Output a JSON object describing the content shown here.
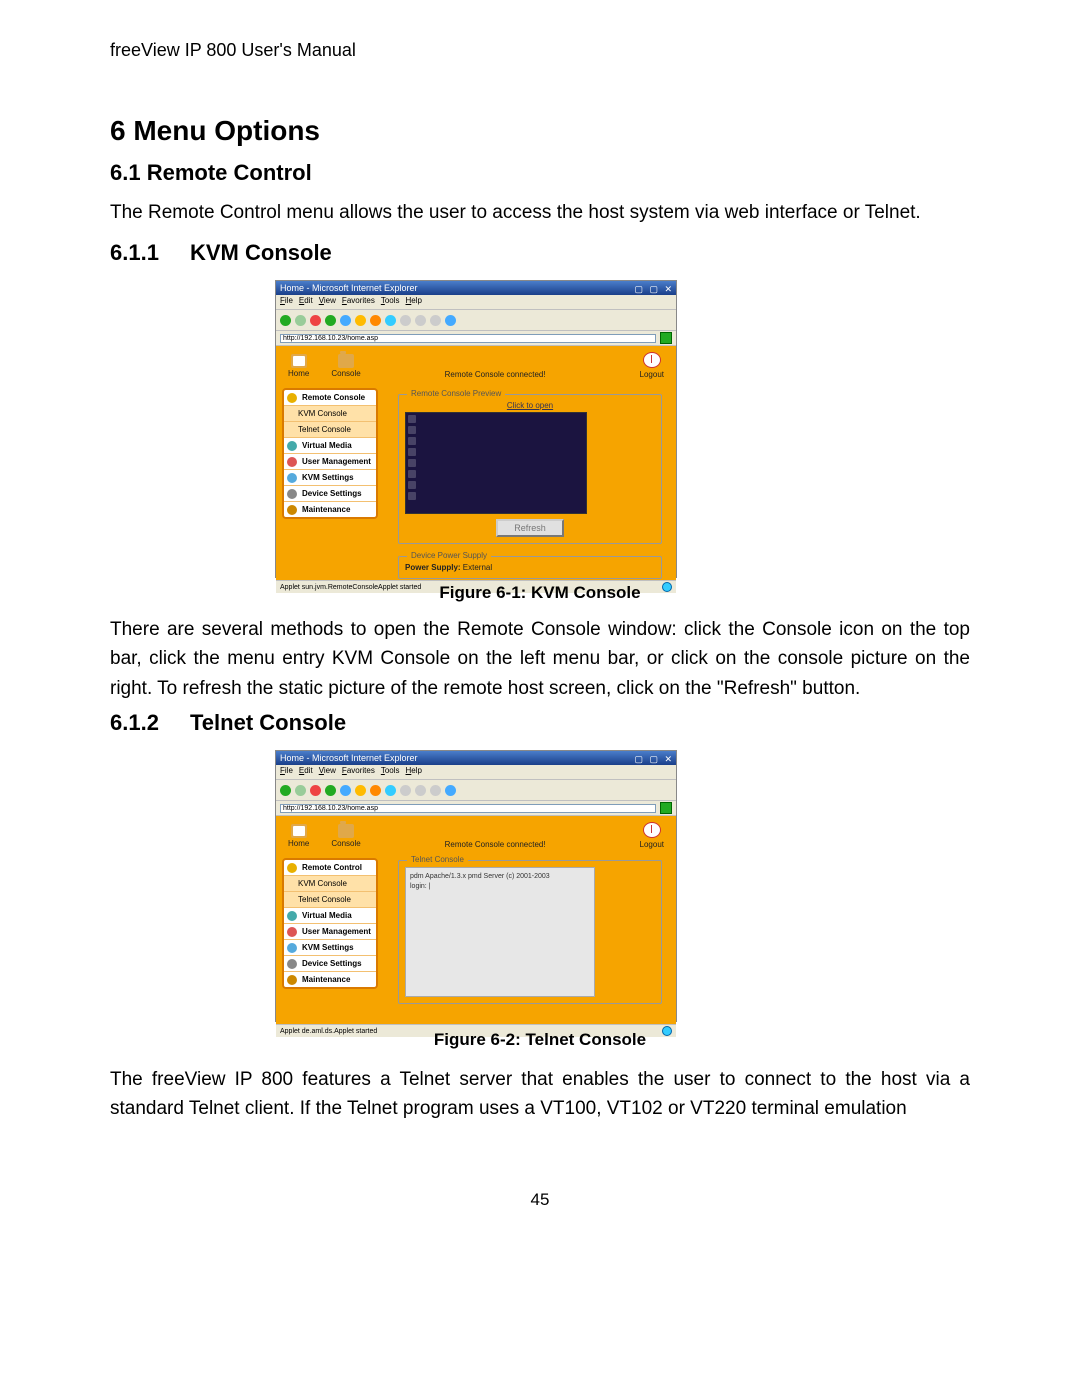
{
  "doc": {
    "header": "freeView IP 800 User's Manual",
    "page_number": "45",
    "h1": "6   Menu Options",
    "s6_1": "6.1    Remote Control",
    "p6_1": "The Remote Control menu allows the user to access the host system via web interface or Telnet.",
    "s6_1_1_num": "6.1.1",
    "s6_1_1_title": "KVM Console",
    "fig1_caption": "Figure 6-1: KVM Console",
    "p6_1_1": "There are several methods to open the Remote Console window: click the Console icon on the top bar, click the menu entry KVM Console on the left menu bar, or click on the console picture on the right. To refresh the static picture of the remote host screen, click on the \"Refresh\" button.",
    "s6_1_2_num": "6.1.2",
    "s6_1_2_title": "Telnet Console",
    "fig2_caption": "Figure 6-2: Telnet Console",
    "p6_1_2": "The freeView IP 800 features a Telnet server that enables the user to connect to the host via a standard Telnet client. If the Telnet program uses a VT100, VT102 or VT220 terminal emulation"
  },
  "browser": {
    "title": "Home - Microsoft Internet Explorer",
    "menus": [
      "File",
      "Edit",
      "View",
      "Favorites",
      "Tools",
      "Help"
    ],
    "address": "http://192.168.10.23/home.asp",
    "status1": "Applet sun.jvm.RemoteConsoleApplet started",
    "status2": "Applet de.aml.ds.Applet started"
  },
  "toolbar_icons": [
    {
      "name": "back-icon",
      "color": "#2a2"
    },
    {
      "name": "forward-icon",
      "color": "#9c9"
    },
    {
      "name": "stop-icon",
      "color": "#e44"
    },
    {
      "name": "refresh-icon",
      "color": "#2a2"
    },
    {
      "name": "home-icon",
      "color": "#4af"
    },
    {
      "name": "search-icon",
      "color": "#fb0"
    },
    {
      "name": "favorites-icon",
      "color": "#f80"
    },
    {
      "name": "history-icon",
      "color": "#3cf"
    },
    {
      "name": "mail-icon",
      "color": "#ccc"
    },
    {
      "name": "print-icon",
      "color": "#ccc"
    },
    {
      "name": "edit-icon",
      "color": "#ccc"
    },
    {
      "name": "msn-icon",
      "color": "#4af"
    }
  ],
  "app": {
    "top": {
      "home": "Home",
      "console": "Console",
      "status": "Remote Console connected!",
      "logout": "Logout"
    },
    "sidebar_fig1": [
      {
        "label": "Remote Console",
        "type": "head",
        "icon": "#e8b000"
      },
      {
        "label": "KVM Console",
        "type": "sub"
      },
      {
        "label": "Telnet Console",
        "type": "sub"
      },
      {
        "label": "Virtual Media",
        "type": "bold",
        "icon": "#4aa"
      },
      {
        "label": "User Management",
        "type": "bold",
        "icon": "#d55"
      },
      {
        "label": "KVM Settings",
        "type": "bold",
        "icon": "#5ad"
      },
      {
        "label": "Device Settings",
        "type": "bold",
        "icon": "#888"
      },
      {
        "label": "Maintenance",
        "type": "bold",
        "icon": "#c80"
      }
    ],
    "sidebar_fig2": [
      {
        "label": "Remote Control",
        "type": "bold",
        "icon": "#e8b000"
      },
      {
        "label": "KVM Console",
        "type": "sub"
      },
      {
        "label": "Telnet Console",
        "type": "sub"
      },
      {
        "label": "Virtual Media",
        "type": "bold",
        "icon": "#4aa"
      },
      {
        "label": "User Management",
        "type": "bold",
        "icon": "#d55"
      },
      {
        "label": "KVM Settings",
        "type": "bold",
        "icon": "#5ad"
      },
      {
        "label": "Device Settings",
        "type": "bold",
        "icon": "#888"
      },
      {
        "label": "Maintenance",
        "type": "bold",
        "icon": "#c80"
      }
    ],
    "preview": {
      "legend": "Remote Console Preview",
      "click": "Click to open",
      "refresh": "Refresh"
    },
    "power": {
      "legend": "Device Power Supply",
      "label": "Power Supply:",
      "value": "External"
    },
    "telnet": {
      "legend": "Telnet Console",
      "line1": "pdm Apache/1.3.x pmd Server (c) 2001-2003",
      "line2": "login: |"
    }
  }
}
